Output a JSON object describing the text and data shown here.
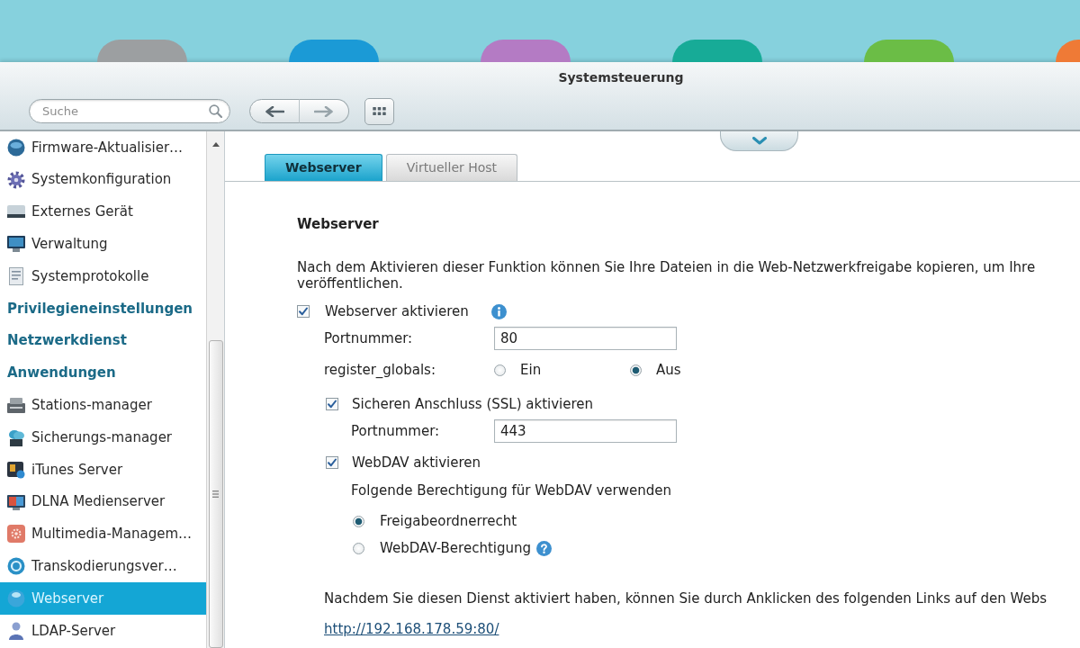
{
  "desktop": {
    "app_icons": [
      {
        "color": "#9c9fa1"
      },
      {
        "color": "#1b9ad6"
      },
      {
        "color": "#b47bc4"
      },
      {
        "color": "#17ab97"
      },
      {
        "color": "#6bbd46"
      },
      {
        "color": "#ef7a36"
      }
    ]
  },
  "window": {
    "title": "Systemsteuerung"
  },
  "toolbar": {
    "search": {
      "placeholder": "Suche"
    },
    "nav": [
      {
        "kind": "back",
        "disabled": false
      },
      {
        "kind": "forward",
        "disabled": true
      }
    ]
  },
  "sidebar": {
    "items": [
      {
        "kind": "item",
        "label": "Firmware-Aktualisier…",
        "selected": false
      },
      {
        "kind": "item",
        "label": "Systemkonfiguration",
        "selected": false
      },
      {
        "kind": "item",
        "label": "Externes Gerät",
        "selected": false
      },
      {
        "kind": "item",
        "label": "Verwaltung",
        "selected": false
      },
      {
        "kind": "item",
        "label": "Systemprotokolle",
        "selected": false
      },
      {
        "kind": "category",
        "label": "Privilegieneinstellungen",
        "selected": false
      },
      {
        "kind": "category",
        "label": "Netzwerkdienst",
        "selected": false
      },
      {
        "kind": "category",
        "label": "Anwendungen",
        "selected": false
      },
      {
        "kind": "item",
        "label": "Stations-manager",
        "selected": false
      },
      {
        "kind": "item",
        "label": "Sicherungs-manager",
        "selected": false
      },
      {
        "kind": "item",
        "label": "iTunes Server",
        "selected": false
      },
      {
        "kind": "item",
        "label": "DLNA Medienserver",
        "selected": false
      },
      {
        "kind": "item",
        "label": "Multimedia-Managem…",
        "selected": false
      },
      {
        "kind": "item",
        "label": "Transkodierungsver…",
        "selected": false
      },
      {
        "kind": "item",
        "label": "Webserver",
        "selected": true
      },
      {
        "kind": "item",
        "label": "LDAP-Server",
        "selected": false
      }
    ]
  },
  "tabs": [
    {
      "label": "Webserver",
      "selected": true
    },
    {
      "label": "Virtueller Host",
      "selected": false
    }
  ],
  "panel": {
    "heading": "Webserver",
    "intro_lines": [
      "Nach dem Aktivieren dieser Funktion können Sie Ihre Dateien in die Web-Netzwerkfreigabe kopieren, um Ihre",
      "veröffentlichen."
    ],
    "webserver": {
      "label": "Webserver aktivieren",
      "checked": true
    },
    "port": {
      "label": "Portnummer:",
      "value": "80"
    },
    "register_globals": {
      "label": "register_globals:",
      "options": [
        {
          "label": "Ein",
          "selected": false
        },
        {
          "label": "Aus",
          "selected": true
        }
      ]
    },
    "ssl": {
      "label": "Sicheren Anschluss (SSL) aktivieren",
      "checked": true
    },
    "ssl_port": {
      "label": "Portnummer:",
      "value": "443"
    },
    "webdav": {
      "label": "WebDAV aktivieren",
      "checked": true
    },
    "webdav_hint": "Folgende Berechtigung für WebDAV verwenden",
    "webdav_permissions": [
      {
        "label": "Freigabeordnerrecht",
        "selected": true
      },
      {
        "label": "WebDAV-Berechtigung",
        "selected": false
      }
    ],
    "link_note": "Nachdem Sie diesen Dienst aktiviert haben, können Sie durch Anklicken des folgenden Links auf den Webs",
    "link": "http://192.168.178.59:80/"
  }
}
